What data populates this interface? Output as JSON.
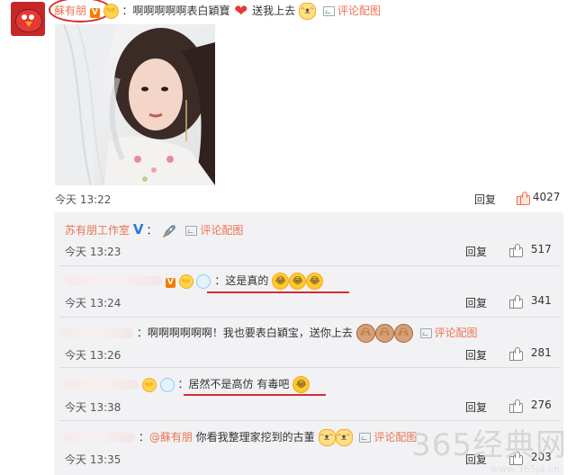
{
  "post": {
    "author": "蘇有朋",
    "text": "：啊啊啊啊啊表白穎寶",
    "text2": "送我上去",
    "pic_link": "评论配图",
    "time": "今天 13:22",
    "reply": "回复",
    "likes": "4027"
  },
  "replies": [
    {
      "author": "苏有朋工作室",
      "text": "：",
      "pic_link": "评论配图",
      "time": "今天 13:23",
      "reply": "回复",
      "likes": "517"
    },
    {
      "author": "",
      "text": "：这是真的",
      "time": "今天 13:24",
      "reply": "回复",
      "likes": "341"
    },
    {
      "author": "",
      "text": "：啊啊啊啊啊啊！我也要表白穎宝，送你上去",
      "pic_link": "评论配图",
      "time": "今天 13:26",
      "reply": "回复",
      "likes": "281"
    },
    {
      "author": "",
      "text_pre": "：",
      "text": "居然不是高仿 有毒吧",
      "time": "今天 13:38",
      "reply": "回复",
      "likes": "276"
    },
    {
      "author": "",
      "text_pre": "：",
      "mention": "@蘇有朋",
      "text": " 你看我整理家挖到的古董",
      "pic_link": "评论配图",
      "time": "今天 13:35",
      "reply": "回复",
      "likes": "203"
    }
  ],
  "watermark": {
    "main": "365经典网",
    "sub": "www.365jd.cn"
  },
  "icons": {
    "badge": "vip-badge-icon",
    "like": "thumbs-up-icon",
    "pic": "image-icon"
  },
  "colors": {
    "name": "#eb7350",
    "highlight_underline": "#d32f2f",
    "panel": "#f2f2f5"
  }
}
